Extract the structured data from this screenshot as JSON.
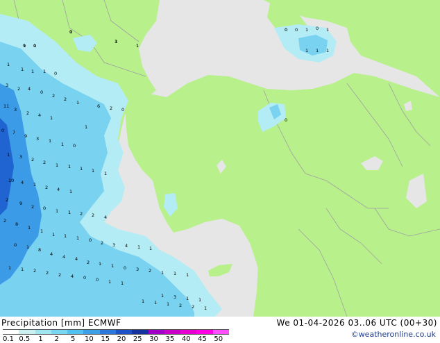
{
  "header": {
    "product": "Precipitation [mm]",
    "model": "ECMWF",
    "datetime": "We 01-04-2026 03..06 UTC (00+30)",
    "credit": "©weatheronline.co.uk"
  },
  "legend": {
    "ticks": [
      "0.1",
      "0.5",
      "1",
      "2",
      "5",
      "10",
      "15",
      "20",
      "25",
      "30",
      "35",
      "40",
      "45",
      "50"
    ],
    "colors": [
      "#ffffff",
      "#c8f0f0",
      "#a0e6f0",
      "#78d6f0",
      "#50c3f0",
      "#3ca0e6",
      "#2c78dc",
      "#1e50c8",
      "#1432a0",
      "#a000c8",
      "#c800c8",
      "#e600d2",
      "#ff00e6",
      "#ff50ff"
    ]
  },
  "colors": {
    "land": "#b8f08c",
    "sea": "#e6e6e6",
    "precip_light": "#b4ecf5",
    "precip_mid": "#78d2f0",
    "precip_heavy": "#3c9be6",
    "precip_max": "#2064d2",
    "border": "#a0a0a0"
  },
  "map_values": [
    "0",
    "9",
    "1",
    "0",
    "1",
    "0",
    "0",
    "1",
    "0",
    "1",
    "1",
    "1",
    "1",
    "0",
    "1",
    "1",
    "1",
    "1",
    "0",
    "3",
    "2",
    "4",
    "0",
    "2",
    "2",
    "1",
    "6",
    "2",
    "0",
    "11",
    "3",
    "2",
    "4",
    "1",
    "0",
    "7",
    "9",
    "3",
    "1",
    "1",
    "0",
    "1",
    "1",
    "3",
    "2",
    "2",
    "1",
    "1",
    "1",
    "1",
    "1",
    "10",
    "4",
    "1",
    "2",
    "4",
    "1",
    "2",
    "9",
    "2",
    "0",
    "1",
    "1",
    "2",
    "2",
    "4",
    "2",
    "8",
    "1",
    "1",
    "1",
    "1",
    "1",
    "0",
    "2",
    "3",
    "4",
    "1",
    "1",
    "0",
    "1",
    "8",
    "4",
    "4",
    "4",
    "2",
    "1",
    "1",
    "0",
    "3",
    "2",
    "1",
    "1",
    "1",
    "1",
    "1",
    "2",
    "2",
    "2",
    "4",
    "0",
    "0",
    "1",
    "1",
    "1",
    "3",
    "1",
    "1",
    "1",
    "1",
    "1",
    "2",
    "2",
    "1",
    "1",
    "1",
    "3",
    "1",
    "1",
    "0"
  ]
}
